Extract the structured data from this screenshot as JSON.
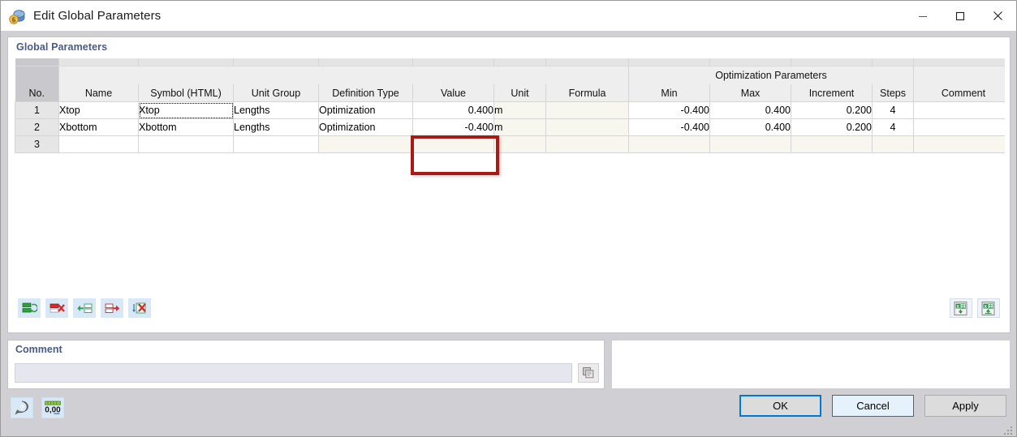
{
  "window": {
    "title": "Edit Global Parameters",
    "icon": "global-parameters-icon",
    "minimize_label": "–",
    "maximize_label": "□",
    "close_label": "✕"
  },
  "group": {
    "title": "Global Parameters"
  },
  "table": {
    "group_header": {
      "optimization_parameters": "Optimization Parameters"
    },
    "columns": [
      "No.",
      "Name",
      "Symbol (HTML)",
      "Unit Group",
      "Definition Type",
      "Value",
      "Unit",
      "Formula",
      "Min",
      "Max",
      "Increment",
      "Steps",
      "Comment"
    ],
    "rows": [
      {
        "no": "1",
        "name": "Xtop",
        "symbol": "Xtop",
        "unit_group": "Lengths",
        "definition_type": "Optimization",
        "value": "0.400",
        "unit": "m",
        "formula": "",
        "min": "-0.400",
        "max": "0.400",
        "increment": "0.200",
        "steps": "4",
        "comment": ""
      },
      {
        "no": "2",
        "name": "Xbottom",
        "symbol": "Xbottom",
        "unit_group": "Lengths",
        "definition_type": "Optimization",
        "value": "-0.400",
        "unit": "m",
        "formula": "",
        "min": "-0.400",
        "max": "0.400",
        "increment": "0.200",
        "steps": "4",
        "comment": ""
      },
      {
        "no": "3",
        "name": "",
        "symbol": "",
        "unit_group": "",
        "definition_type": "",
        "value": "",
        "unit": "",
        "formula": "",
        "min": "",
        "max": "",
        "increment": "",
        "steps": "",
        "comment": ""
      }
    ],
    "highlight": {
      "color": "#a81a16",
      "target_column": "Value"
    }
  },
  "table_toolbar": {
    "left": [
      {
        "name": "insert-row-icon",
        "tooltip": "Insert Row"
      },
      {
        "name": "delete-row-icon",
        "tooltip": "Delete Row"
      },
      {
        "name": "move-left-icon",
        "tooltip": "Move Left"
      },
      {
        "name": "move-right-icon",
        "tooltip": "Move Right"
      },
      {
        "name": "clear-table-icon",
        "tooltip": "Clear Table"
      }
    ],
    "right": [
      {
        "name": "excel-import-icon",
        "tooltip": "Import from MS Excel"
      },
      {
        "name": "excel-export-icon",
        "tooltip": "Export to MS Excel"
      }
    ]
  },
  "comment_section": {
    "title": "Comment",
    "value": "",
    "placeholder": "",
    "dropdown_icon": "chevron-down-icon",
    "side_button_icon": "copy-icon"
  },
  "footer": {
    "icons": [
      {
        "name": "help-icon",
        "tooltip": "Help"
      },
      {
        "name": "number-format-icon",
        "label": "0,00",
        "tooltip": "Decimal Places"
      }
    ],
    "buttons": [
      {
        "name": "ok-button",
        "label": "OK",
        "state": "focused"
      },
      {
        "name": "cancel-button",
        "label": "Cancel",
        "state": "hover"
      },
      {
        "name": "apply-button",
        "label": "Apply",
        "state": "normal"
      }
    ]
  },
  "colors": {
    "group_title": "#4a5a86",
    "highlight": "#a81a16",
    "accent": "#0078d7",
    "header_bg": "#eeeeee",
    "readonly_cell": "#f7f7f0",
    "rownum_bg": "#e6e6e6"
  }
}
